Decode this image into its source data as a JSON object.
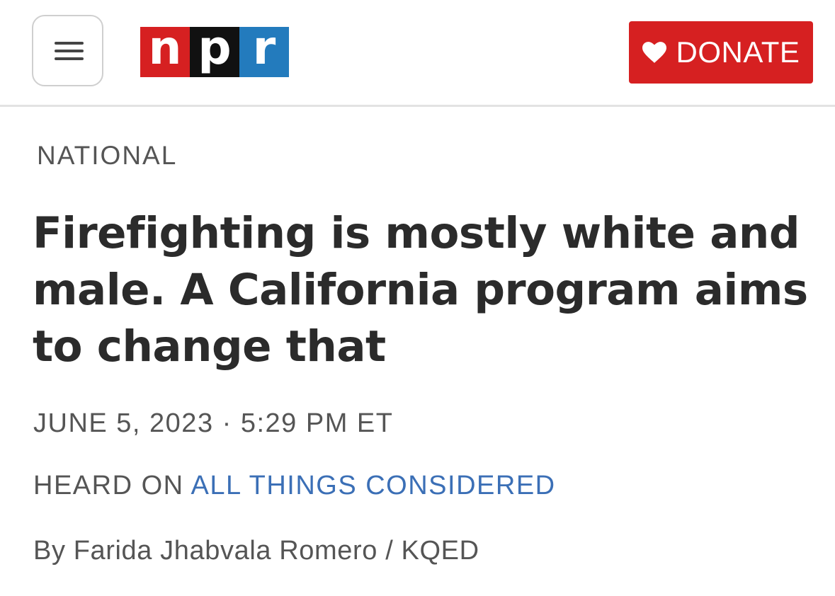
{
  "header": {
    "menu_icon": "hamburger-menu-icon",
    "logo": {
      "letters": [
        "n",
        "p",
        "r"
      ],
      "colors": [
        "#d62021",
        "#111111",
        "#237bbd"
      ]
    },
    "donate": {
      "icon": "heart-icon",
      "label": "DONATE",
      "color": "#d62021"
    }
  },
  "article": {
    "section": "NATIONAL",
    "headline": "Firefighting is mostly white and male. A California program aims to change that",
    "dateline": "JUNE 5, 2023 · 5:29 PM ET",
    "heard_on_prefix": "HEARD ON",
    "program": "ALL THINGS CONSIDERED",
    "byline_prefix": "By",
    "author": "Farida Jhabvala Romero",
    "byline_separator": "/",
    "organization": "KQED"
  },
  "colors": {
    "link": "#3b6fb6",
    "meta_text": "#555555",
    "headline": "#2b2b2b"
  }
}
